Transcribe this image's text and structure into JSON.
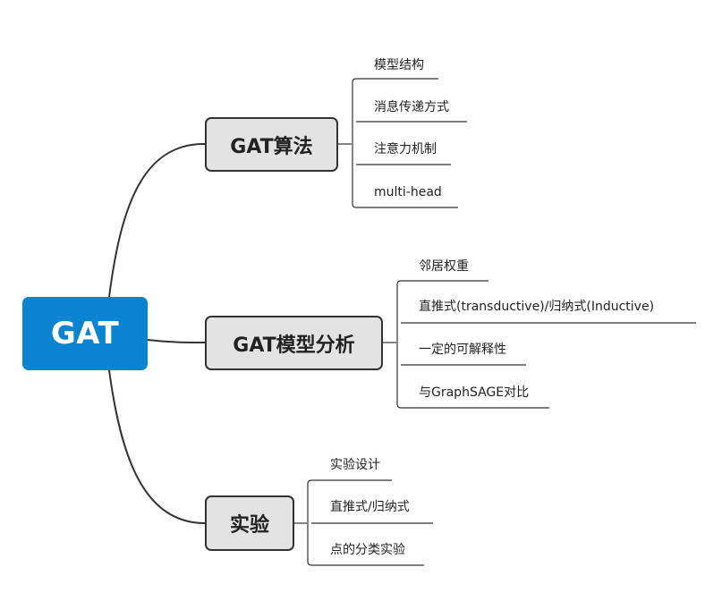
{
  "root": {
    "label": "GAT"
  },
  "branches": [
    {
      "label": "GAT算法",
      "leaves": [
        "模型结构",
        "消息传递方式",
        "注意力机制",
        "multi-head"
      ]
    },
    {
      "label": "GAT模型分析",
      "leaves": [
        "邻居权重",
        "直推式(transductive)/归纳式(Inductive)",
        "一定的可解释性",
        "与GraphSAGE对比"
      ]
    },
    {
      "label": "实验",
      "leaves": [
        "实验设计",
        "直推式/归纳式",
        "点的分类实验"
      ]
    }
  ],
  "colors": {
    "root_fill": "#0a84d0",
    "branch_fill": "#e3e3e3",
    "branch_border": "#333333",
    "line": "#333333"
  }
}
